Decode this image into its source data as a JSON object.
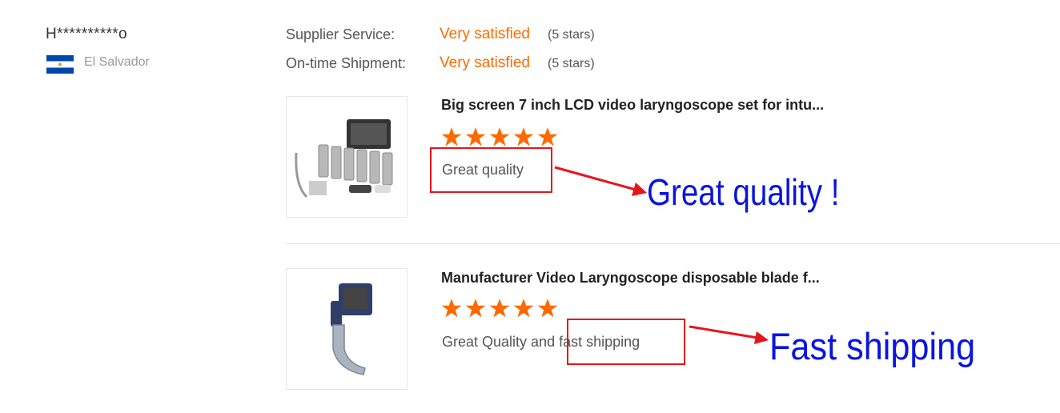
{
  "reviewer": {
    "name": "H**********o",
    "country": "El Salvador",
    "flag_icon": "el-salvador-flag-icon"
  },
  "ratings": [
    {
      "label": "Supplier Service:",
      "value": "Very satisfied",
      "stars": "(5 stars)"
    },
    {
      "label": "On-time Shipment:",
      "value": "Very satisfied",
      "stars": "(5 stars)"
    }
  ],
  "products": [
    {
      "title": "Big screen 7 inch LCD video laryngoscope set for intu...",
      "rating": 5,
      "comment": "Great quality",
      "annotation": "Great quality !"
    },
    {
      "title": "Manufacturer Video Laryngoscope disposable blade f...",
      "rating": 5,
      "comment": "Great Quality and fast shipping",
      "annotation": "Fast shipping"
    }
  ],
  "colors": {
    "accent": "#ff6a00",
    "annotation_blue": "#0a14e0",
    "highlight_red": "#e8141c",
    "flag_blue": "#0047ab"
  }
}
